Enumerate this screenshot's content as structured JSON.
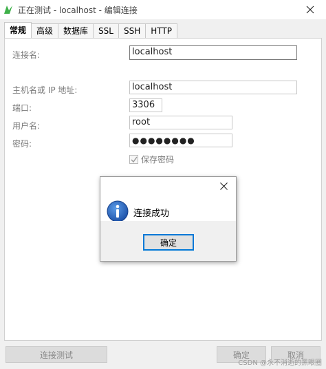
{
  "window": {
    "title": "正在测试 - localhost - 编辑连接",
    "app_icon": "navicat-icon",
    "controls": {
      "close": "×"
    }
  },
  "tabs": [
    {
      "label": "常规",
      "active": true
    },
    {
      "label": "高级",
      "active": false
    },
    {
      "label": "数据库",
      "active": false
    },
    {
      "label": "SSL",
      "active": false
    },
    {
      "label": "SSH",
      "active": false
    },
    {
      "label": "HTTP",
      "active": false
    }
  ],
  "form": {
    "connection_name_label": "连接名:",
    "connection_name_value": "localhost",
    "host_label": "主机名或 IP 地址:",
    "host_value": "localhost",
    "port_label": "端口:",
    "port_value": "3306",
    "user_label": "用户名:",
    "user_value": "root",
    "password_label": "密码:",
    "password_value": "●●●●●●●●",
    "save_password_label": "保存密码",
    "save_password_checked": true
  },
  "buttons": {
    "test_connection": "连接测试",
    "ok": "确定",
    "cancel": "取消"
  },
  "dialog": {
    "message": "连接成功",
    "ok_label": "确定",
    "close_glyph": "×",
    "icon": "info-icon"
  },
  "watermark": "CSDN @永不消逝的黑眼圈",
  "colors": {
    "focus_blue": "#0078d7",
    "info_blue": "#1f5fb5"
  }
}
